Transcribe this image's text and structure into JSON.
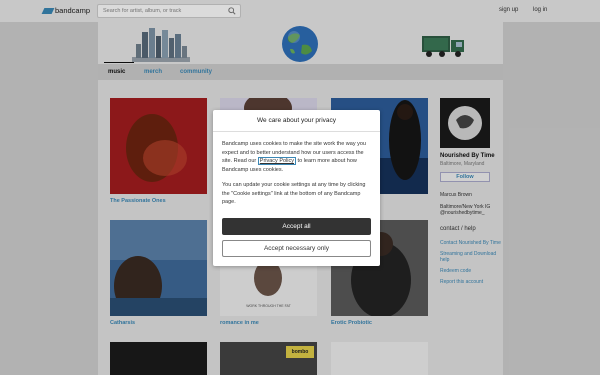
{
  "header": {
    "logo_text": "bandcamp",
    "search_placeholder": "Search for artist, album, or track",
    "signup": "sign up",
    "login": "log in"
  },
  "nav": {
    "tabs": [
      {
        "label": "music",
        "active": true
      },
      {
        "label": "merch",
        "active": false
      },
      {
        "label": "community",
        "active": false
      }
    ]
  },
  "grid": [
    {
      "title": "The Passionate Ones"
    },
    {
      "title": ""
    },
    {
      "title": ""
    },
    {
      "title": "Catharsis"
    },
    {
      "title": "romance in me"
    },
    {
      "title": "Erotic Probiotic"
    },
    {
      "title": ""
    },
    {
      "title": ""
    },
    {
      "title": ""
    }
  ],
  "cover_text": {
    "romance": "WORK THROUGH THE FAT",
    "bombo": "bombo"
  },
  "sidebar": {
    "band_name": "Nourished By Time",
    "location": "Baltimore, Maryland",
    "follow": "Follow",
    "person": "Marcus Brown",
    "bio": "Baltimore/New York IG @nourishedbytime_",
    "contact_header": "contact / help",
    "links": [
      "Contact Nourished By Time",
      "Streaming and Download help",
      "Redeem code",
      "Report this account"
    ]
  },
  "modal": {
    "title": "We care about your privacy",
    "p1_before": "Bandcamp uses cookies to make the site work the way you expect and to better understand how our users access the site. Read our ",
    "privacy_link": "Privacy Policy",
    "p1_after": " to learn more about how Bandcamp uses cookies.",
    "p2": "You can update your cookie settings at any time by clicking the \"Cookie settings\" link at the bottom of any Bandcamp page.",
    "accept_all": "Accept all",
    "accept_necessary": "Accept necessary only"
  },
  "colors": {
    "link": "#3a87b5",
    "accept_button": "#333333"
  }
}
